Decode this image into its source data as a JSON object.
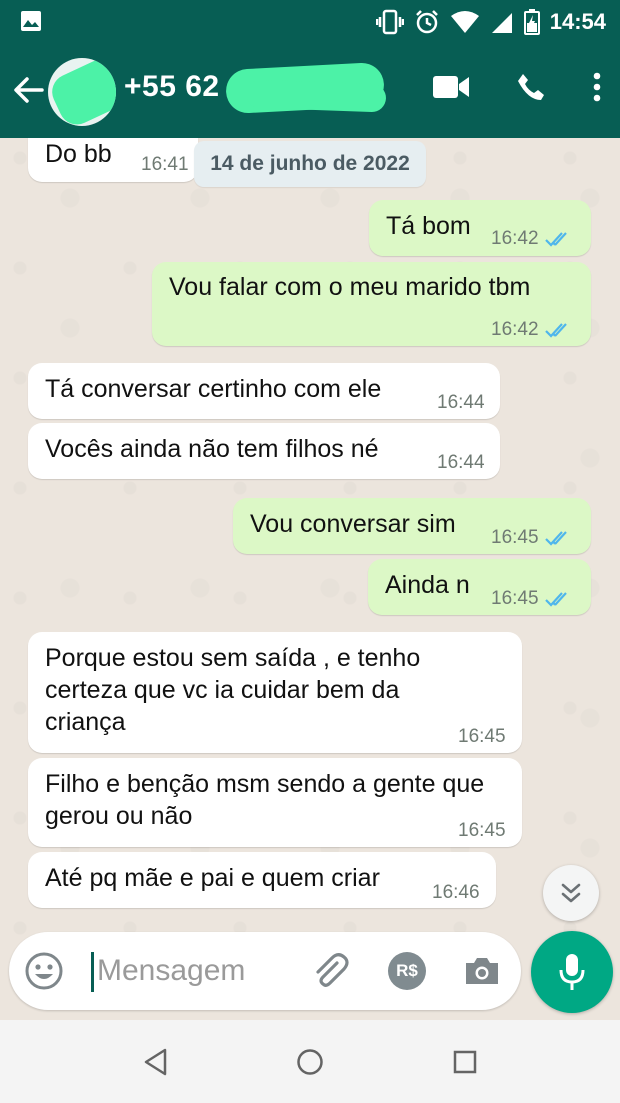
{
  "status_bar": {
    "time": "14:54",
    "icons": [
      "image-notification-icon",
      "vibrate-icon",
      "alarm-icon",
      "wifi-icon",
      "signal-icon",
      "battery-icon"
    ]
  },
  "header": {
    "contact_name": "+55 62",
    "icons": [
      "back-arrow-icon",
      "video-call-icon",
      "phone-icon",
      "more-vert-icon"
    ]
  },
  "chat": {
    "date_chip": "14 de junho de 2022",
    "messages": [
      {
        "dir": "in",
        "text": "Do bb",
        "time": "16:41"
      },
      {
        "dir": "out",
        "text": "Tá bom",
        "time": "16:42",
        "read": true
      },
      {
        "dir": "out",
        "text": "Vou falar com o meu marido tbm",
        "time": "16:42",
        "read": true
      },
      {
        "dir": "in",
        "text": "Tá conversar certinho com ele",
        "time": "16:44"
      },
      {
        "dir": "in",
        "text": "Vocês ainda não tem filhos né",
        "time": "16:44"
      },
      {
        "dir": "out",
        "text": "Vou conversar sim",
        "time": "16:45",
        "read": true
      },
      {
        "dir": "out",
        "text": "Ainda n",
        "time": "16:45",
        "read": true
      },
      {
        "dir": "in",
        "text": "Porque estou sem saída , e tenho certeza que vc ia cuidar bem da criança",
        "time": "16:45"
      },
      {
        "dir": "in",
        "text": "Filho e benção msm sendo a gente que gerou ou não",
        "time": "16:45"
      },
      {
        "dir": "in",
        "text": "Até pq mãe e pai e quem criar",
        "time": "16:46"
      }
    ]
  },
  "composer": {
    "placeholder": "Mensagem",
    "payment_label": "R$",
    "icons": [
      "emoji-icon",
      "attach-icon",
      "payment-icon",
      "camera-icon",
      "mic-icon"
    ]
  },
  "colors": {
    "header": "#075e54",
    "outgoing_bubble": "#dcf8c6",
    "incoming_bubble": "#ffffff",
    "read_ticks": "#4fb6ec",
    "mic_button": "#00a884"
  }
}
